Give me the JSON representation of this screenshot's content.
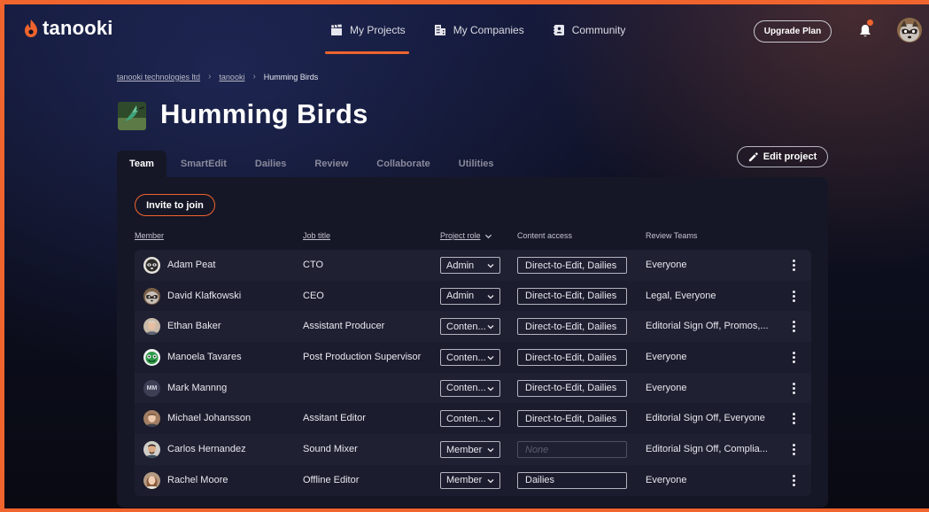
{
  "brand": {
    "name": "tanooki",
    "accent": "#f0642d"
  },
  "nav": {
    "items": [
      {
        "label": "My Projects",
        "icon": "clapperboard-icon",
        "active": true
      },
      {
        "label": "My Companies",
        "icon": "building-icon",
        "active": false
      },
      {
        "label": "Community",
        "icon": "contact-book-icon",
        "active": false
      }
    ],
    "upgrade_label": "Upgrade Plan"
  },
  "breadcrumb": {
    "items": [
      "tanooki technologies ltd",
      "tanooki"
    ],
    "current": "Humming Birds"
  },
  "project": {
    "title": "Humming Birds"
  },
  "tabs": [
    "Team",
    "SmartEdit",
    "Dailies",
    "Review",
    "Collaborate",
    "Utilities"
  ],
  "edit_project_label": "Edit project",
  "invite_label": "Invite to join",
  "columns": {
    "member": "Member",
    "job_title": "Job title",
    "project_role": "Project role",
    "content_access": "Content access",
    "review_teams": "Review Teams"
  },
  "members": [
    {
      "name": "Adam Peat",
      "job": "CTO",
      "role": "Admin",
      "access": "Direct-to-Edit, Dailies",
      "teams": "Everyone"
    },
    {
      "name": "David Klafkowski",
      "job": "CEO",
      "role": "Admin",
      "access": "Direct-to-Edit, Dailies",
      "teams": "Legal, Everyone"
    },
    {
      "name": "Ethan Baker",
      "job": "Assistant Producer",
      "role": "Conten...",
      "access": "Direct-to-Edit, Dailies",
      "teams": "Editorial Sign Off, Promos,..."
    },
    {
      "name": "Manoela Tavares",
      "job": "Post Production Supervisor",
      "role": "Conten...",
      "access": "Direct-to-Edit, Dailies",
      "teams": "Everyone"
    },
    {
      "name": "Mark Mannng",
      "initials": "MM",
      "job": "",
      "role": "Conten...",
      "access": "Direct-to-Edit, Dailies",
      "teams": "Everyone"
    },
    {
      "name": "Michael Johansson",
      "job": "Assitant Editor",
      "role": "Conten...",
      "access": "Direct-to-Edit, Dailies",
      "teams": "Editorial Sign Off, Everyone"
    },
    {
      "name": "Carlos Hernandez",
      "job": "Sound Mixer",
      "role": "Member",
      "access": "None",
      "access_placeholder": true,
      "teams": "Editorial Sign Off, Complia..."
    },
    {
      "name": "Rachel Moore",
      "job": "Offline Editor",
      "role": "Member",
      "access": "Dailies",
      "teams": "Everyone"
    }
  ]
}
